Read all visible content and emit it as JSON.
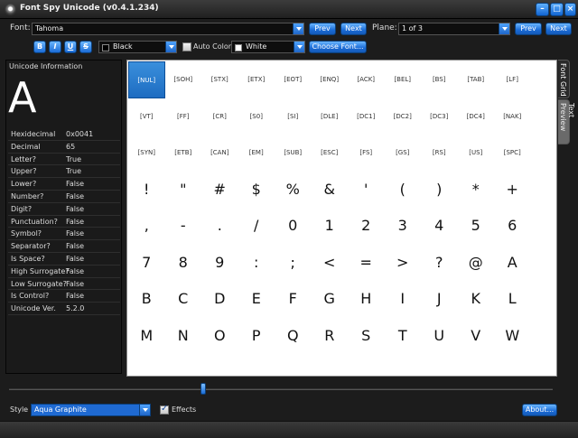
{
  "window": {
    "title": "Font Spy Unicode (v0.4.1.234)"
  },
  "toolbar": {
    "font_label": "Font:",
    "font_value": "Tahoma",
    "prev_label": "Prev",
    "next_label": "Next",
    "plane_label": "Plane:",
    "plane_value": "1 of 3",
    "plane_prev_label": "Prev",
    "plane_next_label": "Next",
    "bold_label": "B",
    "italic_label": "I",
    "underline_label": "U",
    "strike_label": "S",
    "fore_color_value": "Black",
    "auto_color_label": "Auto Color",
    "back_color_value": "White",
    "choose_font_label": "Choose Font...",
    "colors": {
      "fore": "#000000",
      "back": "#ffffff"
    }
  },
  "info": {
    "title": "Unicode Information",
    "char": "A",
    "rows": [
      {
        "k": "Hexidecimal",
        "v": "0x0041"
      },
      {
        "k": "Decimal",
        "v": "65"
      },
      {
        "k": "Letter?",
        "v": "True"
      },
      {
        "k": "Upper?",
        "v": "True"
      },
      {
        "k": "Lower?",
        "v": "False"
      },
      {
        "k": "Number?",
        "v": "False"
      },
      {
        "k": "Digit?",
        "v": "False"
      },
      {
        "k": "Punctuation?",
        "v": "False"
      },
      {
        "k": "Symbol?",
        "v": "False"
      },
      {
        "k": "Separator?",
        "v": "False"
      },
      {
        "k": "Is Space?",
        "v": "False"
      },
      {
        "k": "High Surrogate?",
        "v": "False"
      },
      {
        "k": "Low Surrogate?",
        "v": "False"
      },
      {
        "k": "Is Control?",
        "v": "False"
      },
      {
        "k": "Unicode Ver.",
        "v": "5.2.0"
      }
    ]
  },
  "grid": {
    "selected": 0,
    "cells": [
      "[NUL]",
      "[SOH]",
      "[STX]",
      "[ETX]",
      "[EOT]",
      "[ENQ]",
      "[ACK]",
      "[BEL]",
      "[BS]",
      "[TAB]",
      "[LF]",
      "[VT]",
      "[FF]",
      "[CR]",
      "[S0]",
      "[SI]",
      "[DLE]",
      "[DC1]",
      "[DC2]",
      "[DC3]",
      "[DC4]",
      "[NAK]",
      "[SYN]",
      "[ETB]",
      "[CAN]",
      "[EM]",
      "[SUB]",
      "[ESC]",
      "[FS]",
      "[GS]",
      "[RS]",
      "[US]",
      "[SPC]",
      "!",
      "\"",
      "#",
      "$",
      "%",
      "&",
      "'",
      "(",
      ")",
      "*",
      "+",
      ",",
      "-",
      ".",
      "/",
      "0",
      "1",
      "2",
      "3",
      "4",
      "5",
      "6",
      "7",
      "8",
      "9",
      ":",
      ";",
      "<",
      "=",
      ">",
      "?",
      "@",
      "A",
      "B",
      "C",
      "D",
      "E",
      "F",
      "G",
      "H",
      "I",
      "J",
      "K",
      "L",
      "M",
      "N",
      "O",
      "P",
      "Q",
      "R",
      "S",
      "T",
      "U",
      "V",
      "W"
    ]
  },
  "tabs": {
    "font_grid": "Font Grid",
    "text_preview": "Text Preview"
  },
  "footer": {
    "style_label": "Style",
    "style_value": "Aqua Graphite",
    "effects_label": "Effects",
    "about_label": "About..."
  },
  "slider": {
    "position": 0.36
  }
}
